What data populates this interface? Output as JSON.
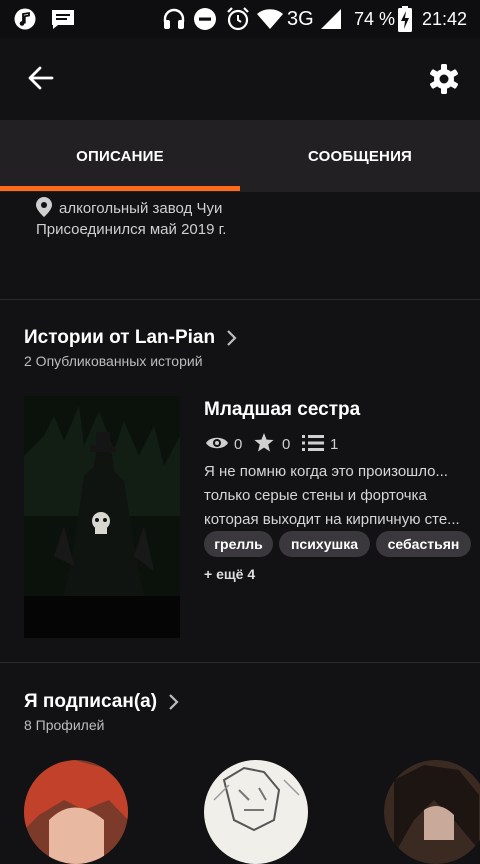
{
  "status_bar": {
    "network": "3G",
    "battery": "74 %",
    "time": "21:42",
    "left_icons": [
      "music-note-icon",
      "message-icon"
    ],
    "right_icons": [
      "headphones-icon",
      "do-not-disturb-icon",
      "alarm-icon",
      "wifi-icon",
      "signal-icon",
      "battery-charging-icon"
    ]
  },
  "app_bar": {
    "back_icon": "arrow-left-icon",
    "settings_icon": "gear-icon"
  },
  "tabs": [
    {
      "label": "ОПИСАНИЕ",
      "active": true
    },
    {
      "label": "СООБЩЕНИЯ",
      "active": false
    }
  ],
  "profile": {
    "location": "алкогольный завод Чуи",
    "joined": "Присоединился май 2019 г."
  },
  "stories": {
    "title": "Истории от Lan-Pian",
    "subtitle": "2 Опубликованных историй",
    "items": [
      {
        "title": "Младшая сестра",
        "views": "0",
        "votes": "0",
        "parts": "1",
        "description_lines": [
          "Я не помню когда это произошло...",
          "только серые стены и форточка",
          "которая выходит на кирпичную сте..."
        ],
        "tags": [
          "грелль",
          "психушка",
          "себастьян"
        ],
        "more_tags": "+ ещё 4"
      }
    ]
  },
  "following": {
    "title": "Я подписан(а)",
    "subtitle": "8 Профилей"
  },
  "colors": {
    "accent": "#ff6a1a",
    "background": "#121113",
    "tab_bar": "#222023"
  }
}
